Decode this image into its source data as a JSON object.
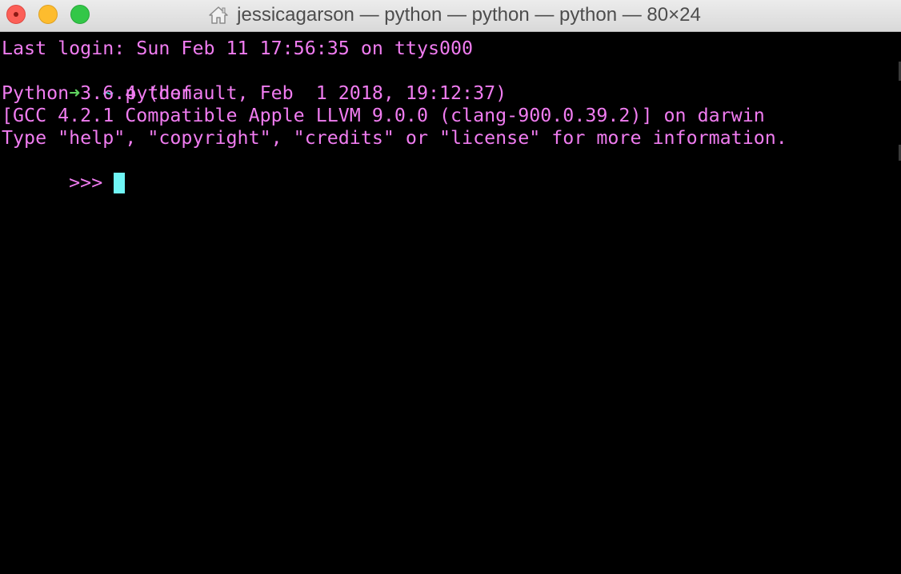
{
  "window": {
    "title": "jessicagarson — python — python — python — 80×24"
  },
  "titlebar": {
    "close_icon": "close-icon",
    "minimize_icon": "minimize-icon",
    "maximize_icon": "maximize-icon",
    "home_icon": "home-icon"
  },
  "terminal": {
    "last_login": "Last login: Sun Feb 11 17:56:35 on ttys000",
    "prompt": {
      "arrow": "➜",
      "cwd": "~",
      "command": "python"
    },
    "python_version": "Python 3.6.4 (default, Feb  1 2018, 19:12:37)",
    "compiler": "[GCC 4.2.1 Compatible Apple LLVM 9.0.0 (clang-900.0.39.2)] on darwin",
    "help_hint": "Type \"help\", \"copyright\", \"credits\" or \"license\" for more information.",
    "repl_prompt": ">>>"
  },
  "colors": {
    "text": "#f07cf0",
    "arrow": "#5fd35f",
    "tilde": "#5ad1d1",
    "cursor": "#6ff6f6",
    "background": "#000000"
  }
}
